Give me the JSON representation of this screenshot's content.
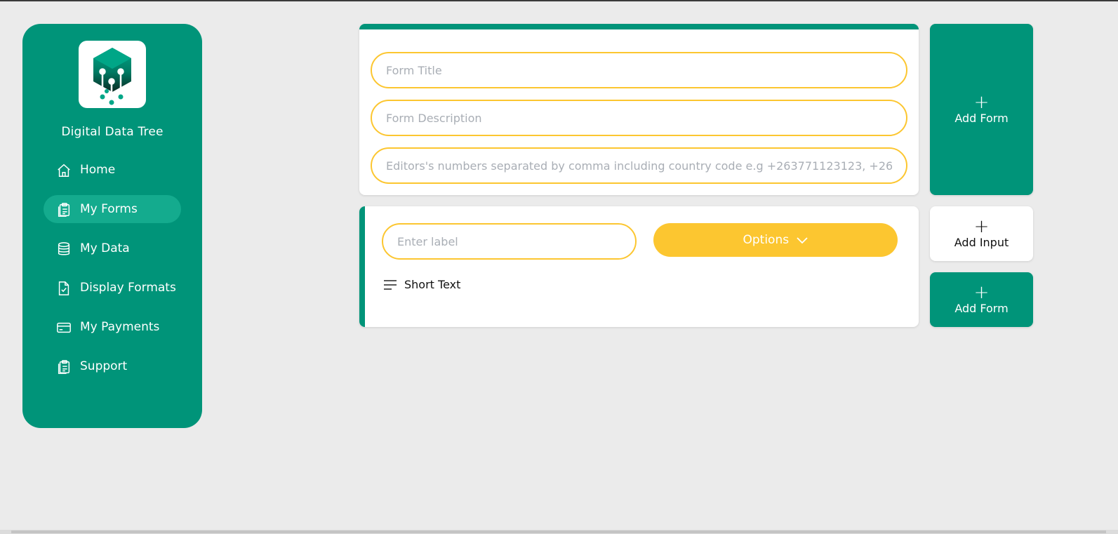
{
  "sidebar": {
    "brand": "Digital Data Tree",
    "logo_icon": "tree-circuit-logo",
    "items": [
      {
        "label": "Home",
        "icon": "home-icon",
        "active": false
      },
      {
        "label": "My Forms",
        "icon": "clipboard-icon",
        "active": true
      },
      {
        "label": "My Data",
        "icon": "database-icon",
        "active": false
      },
      {
        "label": "Display Formats",
        "icon": "file-check-icon",
        "active": false
      },
      {
        "label": "My Payments",
        "icon": "credit-card-icon",
        "active": false
      },
      {
        "label": "Support",
        "icon": "clipboard-icon",
        "active": false
      }
    ]
  },
  "form_header": {
    "title_placeholder": "Form Title",
    "description_placeholder": "Form Description",
    "editors_placeholder": "Editors's numbers separated by comma including country code e.g +263771123123, +263"
  },
  "question": {
    "label_placeholder": "Enter label",
    "options_label": "Options",
    "type_label": "Short Text",
    "type_icon": "lines-icon"
  },
  "actions": {
    "add_form_top": "Add Form",
    "add_input": "Add Input",
    "add_form_bottom": "Add Form",
    "plus": "+"
  },
  "colors": {
    "primary": "#009479",
    "primary_active": "#14ab8e",
    "accent": "#fcc630",
    "background": "#ebebeb"
  }
}
